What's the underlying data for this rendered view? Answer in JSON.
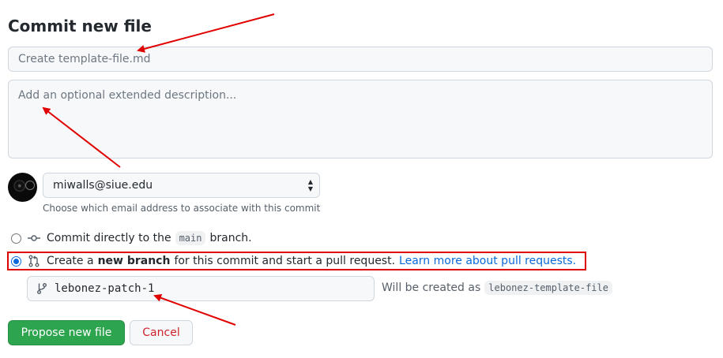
{
  "page": {
    "title": "Commit new file"
  },
  "commit": {
    "summary_placeholder": "Create template-file.md",
    "description_placeholder": "Add an optional extended description..."
  },
  "email": {
    "selected": "miwalls@siue.edu",
    "note": "Choose which email address to associate with this commit"
  },
  "options": {
    "direct": {
      "before": "Commit directly to the",
      "branch": "main",
      "after": "branch."
    },
    "new_branch": {
      "before": "Create a",
      "bold": "new branch",
      "after": "for this commit and start a pull request.",
      "link": "Learn more about pull requests."
    }
  },
  "branch": {
    "name": "lebonez-patch-1",
    "will_be_created_label": "Will be created as",
    "will_be_created_value": "lebonez-template-file"
  },
  "buttons": {
    "propose": "Propose new file",
    "cancel": "Cancel"
  },
  "colors": {
    "primary_button": "#2da44e",
    "cancel_text": "#cf222e",
    "link": "#0969da",
    "annotation_red": "#e00000"
  },
  "icons": {
    "commit": "git-commit-icon",
    "pull_request": "git-pull-request-icon",
    "branch": "git-branch-icon",
    "select": "select-arrows-icon"
  }
}
